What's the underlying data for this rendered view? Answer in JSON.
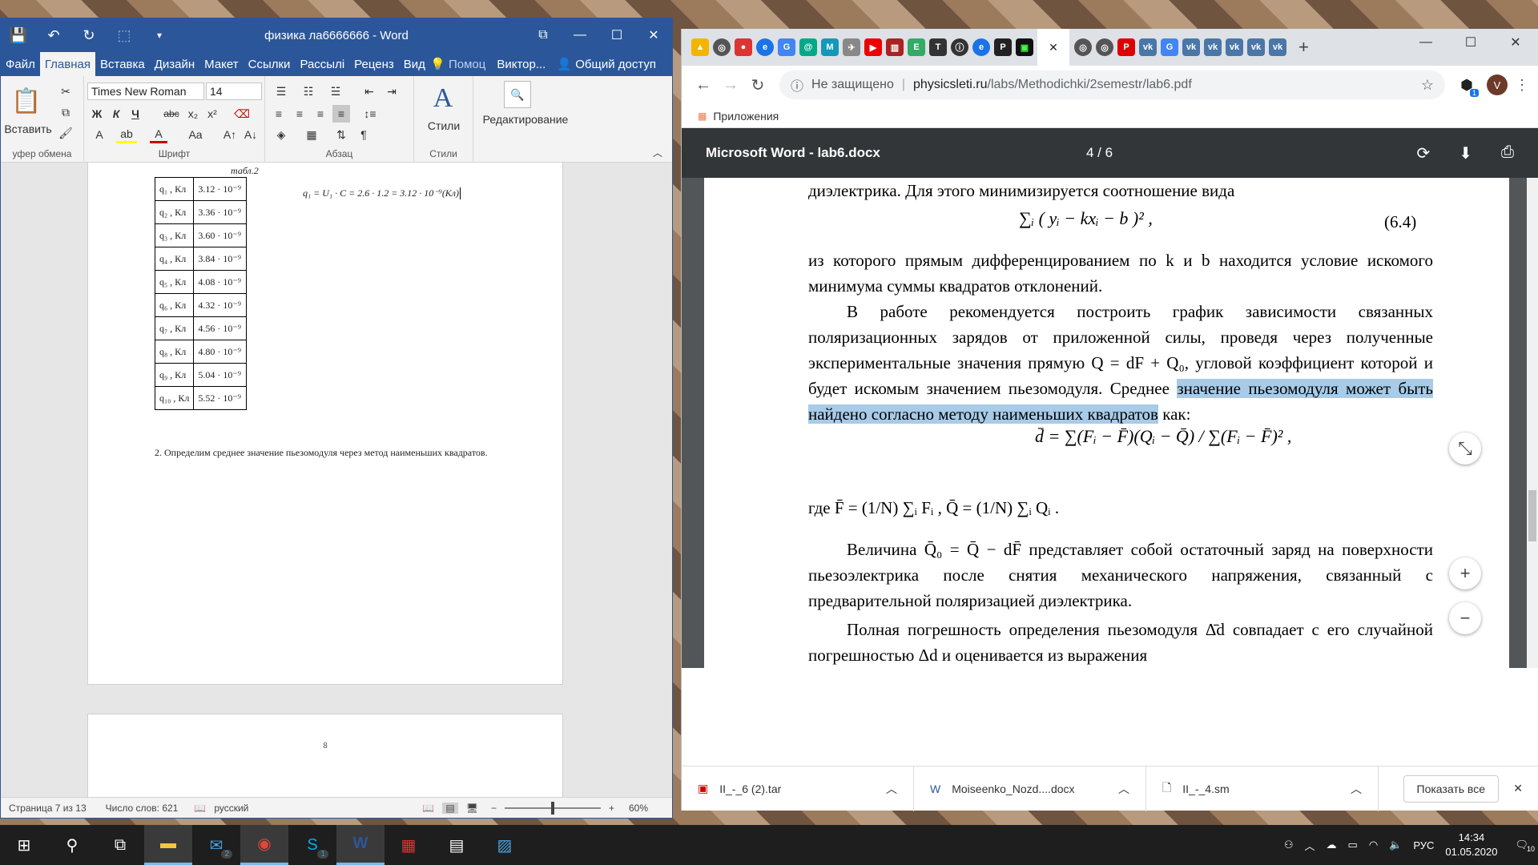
{
  "word": {
    "title": "физика ла6666666 - Word",
    "menu_tabs": [
      "Файл",
      "Главная",
      "Вставка",
      "Дизайн",
      "Макет",
      "Ссылки",
      "Рассылі",
      "Реценз",
      "Вид"
    ],
    "tell_me": "Помоц",
    "user": "Виктор...",
    "share": "Общий доступ",
    "ribbon": {
      "paste_label": "Вставить",
      "clipboard_label": "уфер обмена",
      "font_label": "Шрифт",
      "paragraph_label": "Абзац",
      "styles_label": "Стили",
      "styles_group_label": "Стили",
      "editing_label": "Редактирование",
      "font_name": "Times New Roman",
      "font_size": "14"
    },
    "document": {
      "table_caption": "табл.2",
      "rows": [
        {
          "label": "q₁ , Кл",
          "value": "3.12 · 10⁻⁹"
        },
        {
          "label": "q₂ , Кл",
          "value": "3.36 · 10⁻⁹"
        },
        {
          "label": "q₃ , Кл",
          "value": "3.60 · 10⁻⁹"
        },
        {
          "label": "q₄ , Кл",
          "value": "3.84 · 10⁻⁹"
        },
        {
          "label": "q₅ , Кл",
          "value": "4.08 · 10⁻⁹"
        },
        {
          "label": "q₆ , Кл",
          "value": "4.32 · 10⁻⁹"
        },
        {
          "label": "q₇ , Кл",
          "value": "4.56 · 10⁻⁹"
        },
        {
          "label": "q₈ , Кл",
          "value": "4.80 · 10⁻⁹"
        },
        {
          "label": "q₉ , Кл",
          "value": "5.04 · 10⁻⁹"
        },
        {
          "label": "q₁₀ , Кл",
          "value": "5.52 · 10⁻⁹"
        }
      ],
      "formula": "q₁ = U₁ · C = 2.6 · 1.2 = 3.12 · 10⁻⁹(Кл)",
      "paragraph": "2. Определим среднее значение пьезомодуля через метод наименьших квадратов.",
      "page_number": "8"
    },
    "status": {
      "page": "Страница 7 из 13",
      "words": "Число слов: 621",
      "language": "русский",
      "zoom": "60%"
    }
  },
  "chrome": {
    "url_security": "Не защищено",
    "url_host": "physicsleti.ru",
    "url_path": "/labs/Methodichki/2semestr/lab6.pdf",
    "bookmarks_label": "Приложения",
    "profile_initial": "V",
    "extension_badge": "1",
    "pdf": {
      "title": "Microsoft Word - lab6.docx",
      "page_indicator": "4 / 6",
      "lines": {
        "l1": "диэлектрика. Для этого минимизируется соотношение вида",
        "eq64_formula": "∑ᵢ ( yᵢ − kxᵢ − b )² ,",
        "eq64_number": "(6.4)",
        "l2": "из которого прямым дифференцированием по k и b находится условие искомого минимума суммы квадратов отклонений.",
        "l3a": "В работе рекомендуется построить график зависимости связанных поляризационных зарядов от приложенной силы, проведя через полученные экспериментальные значения прямую Q = dF + Q₀, угловой коэффициент которой и будет искомым значением пьезомодуля. Среднее ",
        "l3_highlight": "значение пьезомодуля может быть найдено согласно методу наименьших квадратов",
        "l3b": " как:",
        "dbar_formula": "d̄ = ∑(Fᵢ − F̄)(Qᵢ − Q̄) / ∑(Fᵢ − F̄)² ,",
        "where_formula": "где  F̄ = (1/N) ∑ᵢ Fᵢ ,  Q̄ = (1/N) ∑ᵢ Qᵢ .",
        "l4": "Величина  Q̄₀ = Q̄ − dF̄  представляет собой остаточный заряд на поверхности пьезоэлектрика после снятия механического напряжения, связанный с предварительной поляризацией диэлектрика.",
        "l5": "Полная погрешность определения пьезомодуля Δ̄d совпадает с его случайной погрешностью Δd и оценивается из выражения"
      }
    },
    "downloads": [
      {
        "name": "II_-_6 (2).tar"
      },
      {
        "name": "Moiseenko_Nozd....docx"
      },
      {
        "name": "II_-_4.sm"
      }
    ],
    "show_all": "Показать все"
  },
  "taskbar": {
    "mail_badge": "2",
    "skype_badge": "1",
    "language": "РУС",
    "time": "14:34",
    "date": "01.05.2020",
    "notifications": "10"
  },
  "colors": {
    "word_blue": "#2b579a",
    "pdf_toolbar": "#323639",
    "highlight": "#a8cbe8"
  }
}
